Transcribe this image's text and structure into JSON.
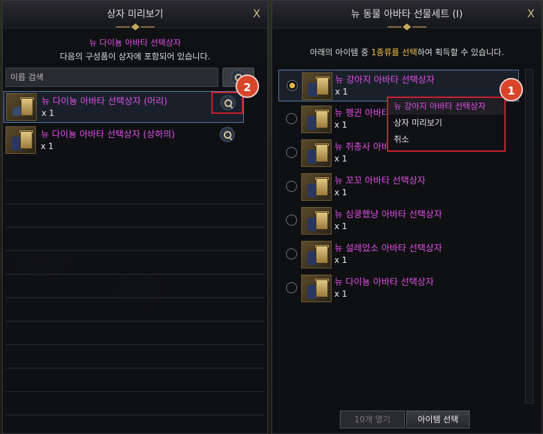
{
  "left_panel": {
    "title": "상자 미리보기",
    "close": "X",
    "box_name": "뉴 다이뇽 아바타 선택상자",
    "description": "다음의 구성품이 상자에 포함되어 있습니다.",
    "search_placeholder": "이름 검색",
    "items": [
      {
        "name": "뉴 다이뇽 아바타 선택상자 (머리)",
        "qty": "x 1"
      },
      {
        "name": "뉴 다이뇽 아바타 선택상자 (상하의)",
        "qty": "x 1"
      }
    ]
  },
  "right_panel": {
    "title": "뉴 동물 아바타 선물세트 (I)",
    "close": "X",
    "instruction_pre": "아래의 아이템 중 ",
    "instruction_highlight": "1종류를 선택",
    "instruction_post": "하여 획득할 수 있습니다.",
    "items": [
      {
        "name": "뉴 강아지 아바타 선택상자",
        "qty": "x 1",
        "selected": true
      },
      {
        "name": "뉴 펭귄 아바타 선택상자",
        "qty": "x 1",
        "selected": false
      },
      {
        "name": "뉴 쥐총사 아바타 선택상자",
        "qty": "x 1",
        "selected": false
      },
      {
        "name": "뉴 꼬꼬 아바타 선택상자",
        "qty": "x 1",
        "selected": false
      },
      {
        "name": "뉴 심쿵했냥 아바타 선택상자",
        "qty": "x 1",
        "selected": false
      },
      {
        "name": "뉴 설레었소 아바타 선택상자",
        "qty": "x 1",
        "selected": false
      },
      {
        "name": "뉴 다이뇽 아바타 선택상자",
        "qty": "x 1",
        "selected": false
      }
    ],
    "open_ten_button": "10개 열기",
    "select_button": "아이템 선택"
  },
  "context_menu": {
    "items": [
      "뉴 강아지 아바타 선택상자",
      "상자 미리보기",
      "취소"
    ]
  },
  "annotations": {
    "badge1": "1",
    "badge2": "2"
  },
  "colors": {
    "item_name": "#e050e8",
    "highlight": "#f2c14e",
    "annotation_red": "#d02030"
  }
}
